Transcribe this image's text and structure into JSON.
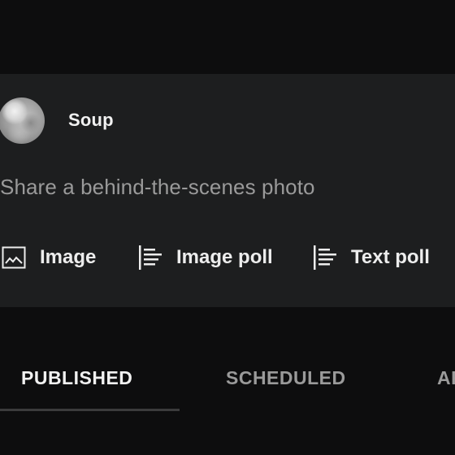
{
  "composer": {
    "channel_name": "Soup",
    "prompt_text": "Share a behind-the-scenes photo",
    "actions": [
      {
        "label": "Image",
        "icon": "image-icon"
      },
      {
        "label": "Image poll",
        "icon": "poll-icon"
      },
      {
        "label": "Text poll",
        "icon": "poll-icon"
      }
    ]
  },
  "tabs": [
    {
      "label": "PUBLISHED",
      "selected": true
    },
    {
      "label": "SCHEDULED",
      "selected": false
    },
    {
      "label": "AR",
      "selected": false
    }
  ],
  "colors": {
    "page_background": "#0d0d0e",
    "card_background": "#1d1e1f",
    "primary_text": "#f1f1f1",
    "secondary_text": "#9a9a9a"
  }
}
